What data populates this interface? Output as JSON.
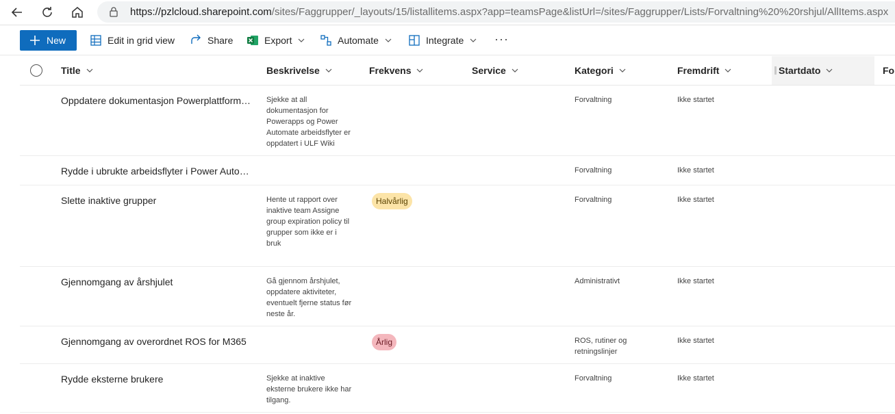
{
  "browser": {
    "url_host": "https://pzlcloud.sharepoint.com",
    "url_path": "/sites/Faggrupper/_layouts/15/listallitems.aspx?app=teamsPage&listUrl=/sites/Faggrupper/Lists/Forvaltning%20%20rshjul/AllItems.aspx"
  },
  "commandbar": {
    "new_label": "New",
    "edit_grid_label": "Edit in grid view",
    "share_label": "Share",
    "export_label": "Export",
    "automate_label": "Automate",
    "integrate_label": "Integrate",
    "more_label": "···"
  },
  "columns": {
    "title": "Title",
    "beskrivelse": "Beskrivelse",
    "frekvens": "Frekvens",
    "service": "Service",
    "kategori": "Kategori",
    "fremdrift": "Fremdrift",
    "startdato": "Startdato",
    "next": "For"
  },
  "rows": [
    {
      "title": "Oppdatere dokumentasjon Powerplattform…",
      "beskrivelse": "Sjekke at all dokumentasjon for Powerapps og Power Automate arbeidsflyter er oppdatert i ULF Wiki",
      "frekvens": "",
      "kategori": "Forvaltning",
      "fremdrift": "Ikke startet"
    },
    {
      "title": "Rydde i ubrukte arbeidsflyter i Power Auto…",
      "beskrivelse": "",
      "frekvens": "",
      "kategori": "Forvaltning",
      "fremdrift": "Ikke startet"
    },
    {
      "title": "Slette inaktive grupper",
      "beskrivelse": "Hente ut rapport over inaktive team Assigne group expiration policy til grupper som ikke er i bruk",
      "frekvens": "Halvårlig",
      "kategori": "Forvaltning",
      "fremdrift": "Ikke startet"
    },
    {
      "title": "Gjennomgang av årshjulet",
      "beskrivelse": "Gå gjennom årshjulet, oppdatere aktiviteter, eventuelt fjerne status før neste år.",
      "frekvens": "",
      "kategori": "Administrativt",
      "fremdrift": "Ikke startet"
    },
    {
      "title": "Gjennomgang av overordnet ROS for M365",
      "beskrivelse": "",
      "frekvens": "Årlig",
      "kategori": "ROS, rutiner og retningslinjer",
      "fremdrift": "Ikke startet"
    },
    {
      "title": "Rydde eksterne brukere",
      "beskrivelse": "Sjekke at inaktive eksterne brukere ikke har tilgang.",
      "frekvens": "",
      "kategori": "Forvaltning",
      "fremdrift": "Ikke startet"
    }
  ],
  "colors": {
    "accent": "#0f6cbd",
    "pill_halvarlig": "#fce4a8",
    "pill_arlig": "#f4b7bd"
  }
}
